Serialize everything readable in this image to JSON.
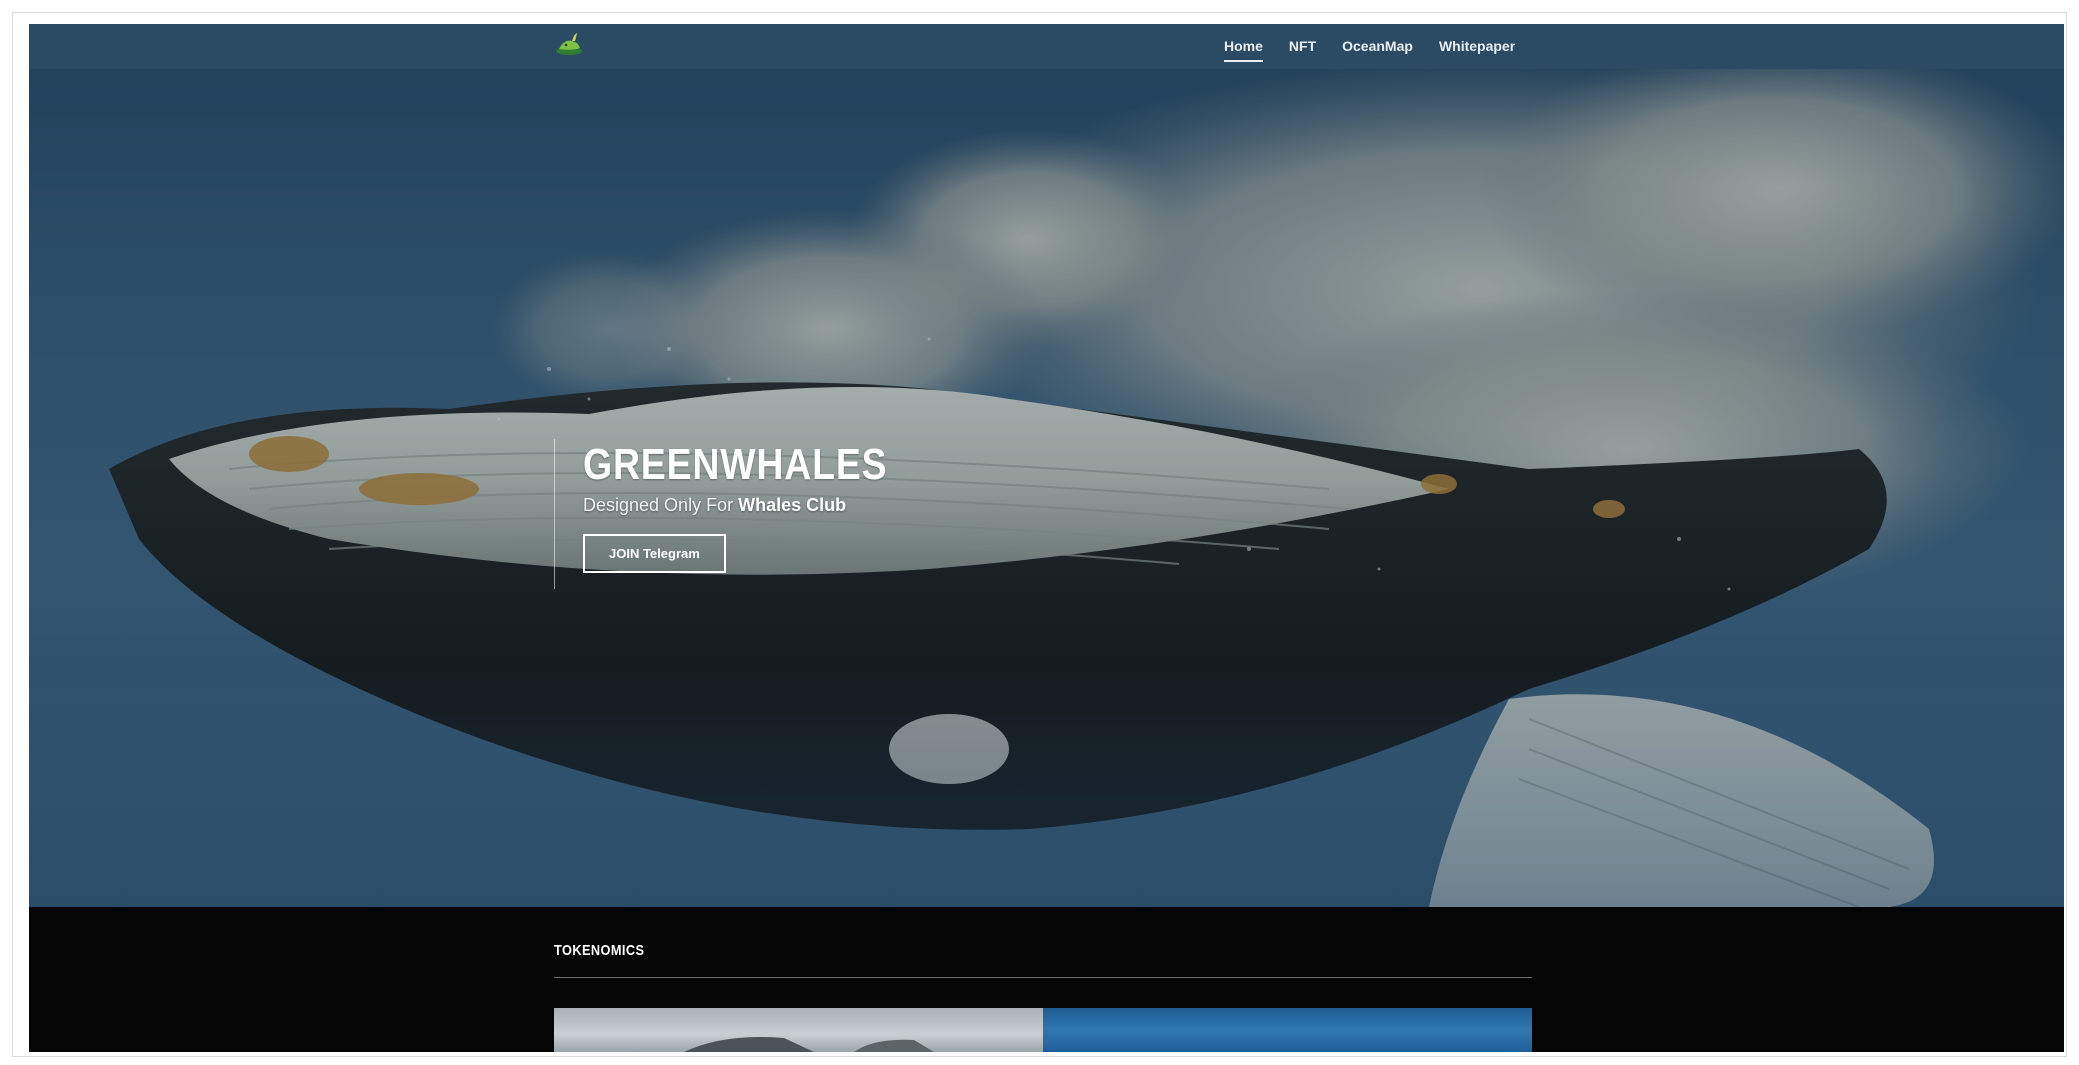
{
  "nav": {
    "logo_icon": "green-whale-logo-icon",
    "items": [
      {
        "label": "Home",
        "active": true
      },
      {
        "label": "NFT",
        "active": false
      },
      {
        "label": "OceanMap",
        "active": false
      },
      {
        "label": "Whitepaper",
        "active": false
      }
    ]
  },
  "hero": {
    "title": "GREENWHALES",
    "subtitle_prefix": "Designed Only For ",
    "subtitle_emphasis": "Whales Club",
    "button_label": "JOIN Telegram",
    "background_image": "humpback-whale-breaching-photo"
  },
  "tokenomics": {
    "title": "TOKENOMICS",
    "thumbnails": [
      {
        "image": "whale-on-ice-photo"
      },
      {
        "image": "blue-ocean-photo"
      }
    ]
  },
  "colors": {
    "navbar": "#2b4a63",
    "hero_sky": "#3b6383",
    "section_bg": "#050505",
    "text": "#ffffff"
  }
}
